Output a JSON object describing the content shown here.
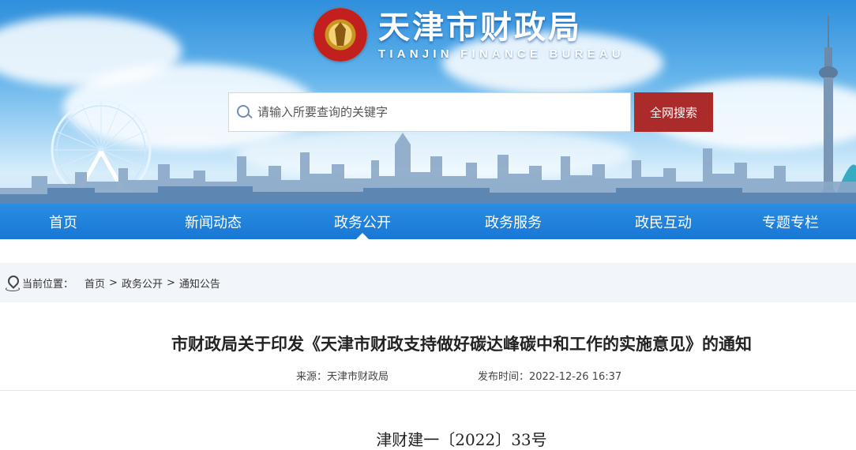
{
  "header": {
    "title_cn": "天津市财政局",
    "title_en": "TIANJIN FINANCE BUREAU",
    "emblem": "emblem-icon"
  },
  "search": {
    "placeholder": "请输入所要查询的关键字",
    "button_label": "全网搜索",
    "button_color": "#ab2a2a"
  },
  "nav": {
    "color": "#1a7fdb",
    "items": [
      {
        "label": "首页"
      },
      {
        "label": "新闻动态"
      },
      {
        "label": "政务公开",
        "active": true
      },
      {
        "label": "政务服务"
      },
      {
        "label": "政民互动"
      },
      {
        "label": "专题专栏"
      }
    ]
  },
  "breadcrumb": {
    "label": "当前位置：",
    "items": [
      "首页",
      "政务公开",
      "通知公告"
    ],
    "separator": ">"
  },
  "article": {
    "title": "市财政局关于印发《天津市财政支持做好碳达峰碳中和工作的实施意见》的通知",
    "source_label": "来源：",
    "source": "天津市财政局",
    "date_label": "发布时间：",
    "date": "2022-12-26 16:37",
    "doc_number": "津财建一〔2022〕33号"
  }
}
